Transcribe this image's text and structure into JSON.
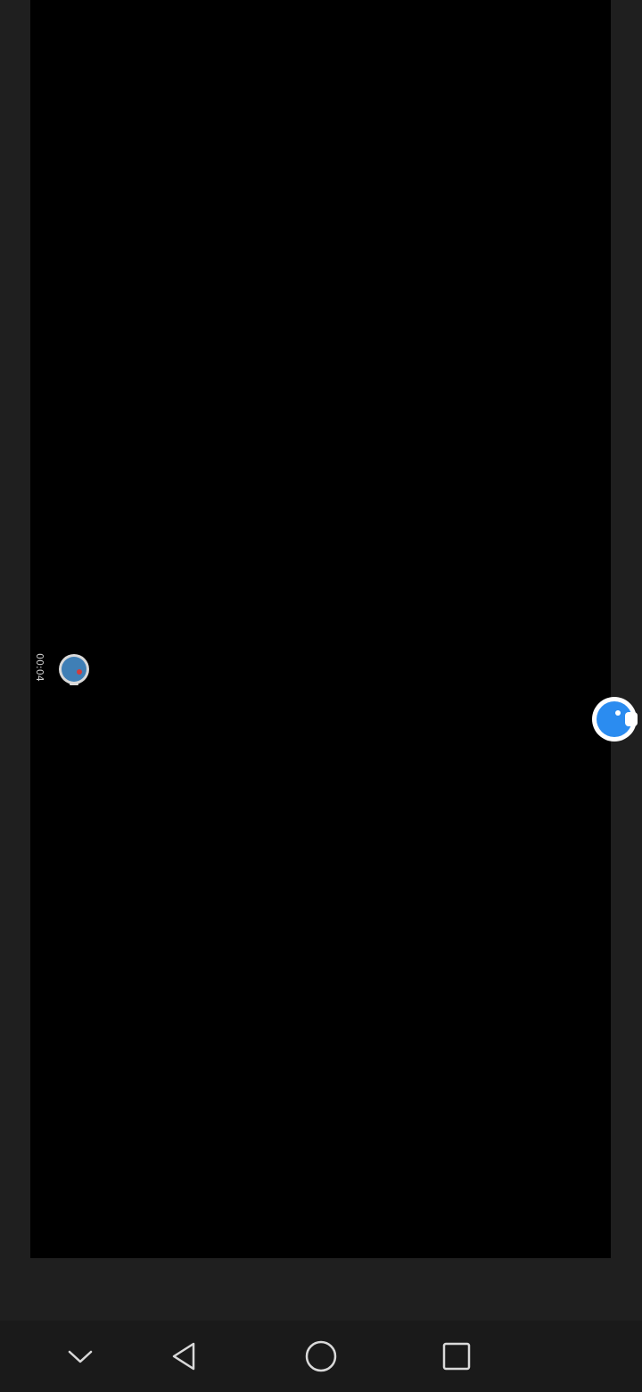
{
  "recording": {
    "time": "00:04",
    "icon": "recording-dot-icon"
  },
  "floating_button": {
    "icon": "floating-bubble-icon",
    "color": "#2b8cf0"
  },
  "navigation": {
    "collapse_icon": "chevron-down-icon",
    "back_icon": "back-triangle-icon",
    "home_icon": "home-circle-icon",
    "recents_icon": "recents-square-icon"
  },
  "colors": {
    "background": "#1f1f1f",
    "viewport": "#000000",
    "accent": "#2b8cf0",
    "navbar": "#1a1a1a"
  }
}
